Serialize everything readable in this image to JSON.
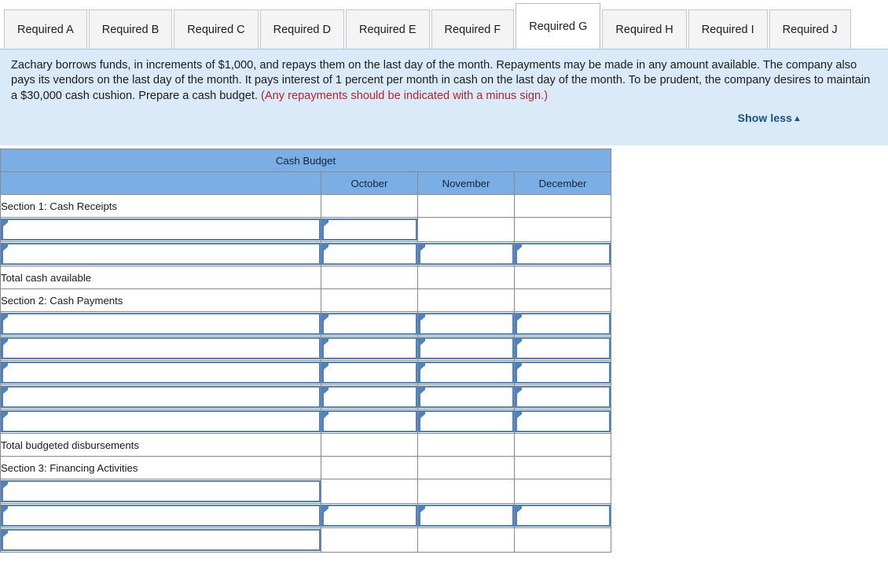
{
  "tabs": [
    {
      "label": "Required A",
      "active": false
    },
    {
      "label": "Required B",
      "active": false
    },
    {
      "label": "Required C",
      "active": false
    },
    {
      "label": "Required D",
      "active": false
    },
    {
      "label": "Required E",
      "active": false
    },
    {
      "label": "Required F",
      "active": false
    },
    {
      "label": "Required G",
      "active": true
    },
    {
      "label": "Required H",
      "active": false
    },
    {
      "label": "Required I",
      "active": false
    },
    {
      "label": "Required J",
      "active": false
    }
  ],
  "instructions": {
    "body": "Zachary borrows funds, in increments of $1,000, and repays them on the last day of the month. Repayments may be made in any amount available. The company also pays its vendors on the last day of the month. It pays interest of 1 percent per month in cash on the last day of the month. To be prudent, the company desires to maintain a $30,000 cash cushion. Prepare a cash budget. ",
    "hint": "(Any repayments should be indicated with a minus sign.)",
    "show_less_label": "Show less",
    "show_less_caret": "▲",
    "panel_bg": "#daeaf8",
    "hint_color": "#b32430",
    "link_color": "#1a4e87"
  },
  "table": {
    "title": "Cash Budget",
    "header_bg": "#7baee4",
    "input_border": "#4f81bd",
    "columns": [
      "",
      "October",
      "November",
      "December"
    ],
    "rows": [
      {
        "label": "Section 1: Cash Receipts",
        "label_input": false,
        "cells": [
          "plain",
          "plain",
          "plain"
        ]
      },
      {
        "label": "",
        "label_input": true,
        "cells": [
          "input",
          "plain",
          "plain"
        ]
      },
      {
        "label": "",
        "label_input": true,
        "cells": [
          "input",
          "input",
          "input"
        ]
      },
      {
        "label": "Total cash available",
        "label_input": false,
        "cells": [
          "total",
          "total",
          "total"
        ]
      },
      {
        "label": "Section 2: Cash Payments",
        "label_input": false,
        "cells": [
          "plain",
          "plain",
          "plain"
        ]
      },
      {
        "label": "",
        "label_input": true,
        "cells": [
          "input",
          "input",
          "input"
        ]
      },
      {
        "label": "",
        "label_input": true,
        "cells": [
          "input",
          "input",
          "input"
        ]
      },
      {
        "label": "",
        "label_input": true,
        "cells": [
          "input",
          "input",
          "input"
        ]
      },
      {
        "label": "",
        "label_input": true,
        "cells": [
          "input",
          "input",
          "input"
        ]
      },
      {
        "label": "",
        "label_input": true,
        "cells": [
          "input",
          "input",
          "input"
        ]
      },
      {
        "label": "Total budgeted disbursements",
        "label_input": false,
        "cells": [
          "total",
          "total",
          "total"
        ]
      },
      {
        "label": "Section 3: Financing Activities",
        "label_input": false,
        "cells": [
          "plain",
          "plain",
          "plain"
        ]
      },
      {
        "label": "",
        "label_input": true,
        "cells": [
          "plain",
          "plain",
          "plain"
        ]
      },
      {
        "label": "",
        "label_input": true,
        "cells": [
          "input",
          "input",
          "input"
        ]
      },
      {
        "label": "",
        "label_input": true,
        "cells": [
          "total",
          "total",
          "total"
        ]
      }
    ]
  }
}
